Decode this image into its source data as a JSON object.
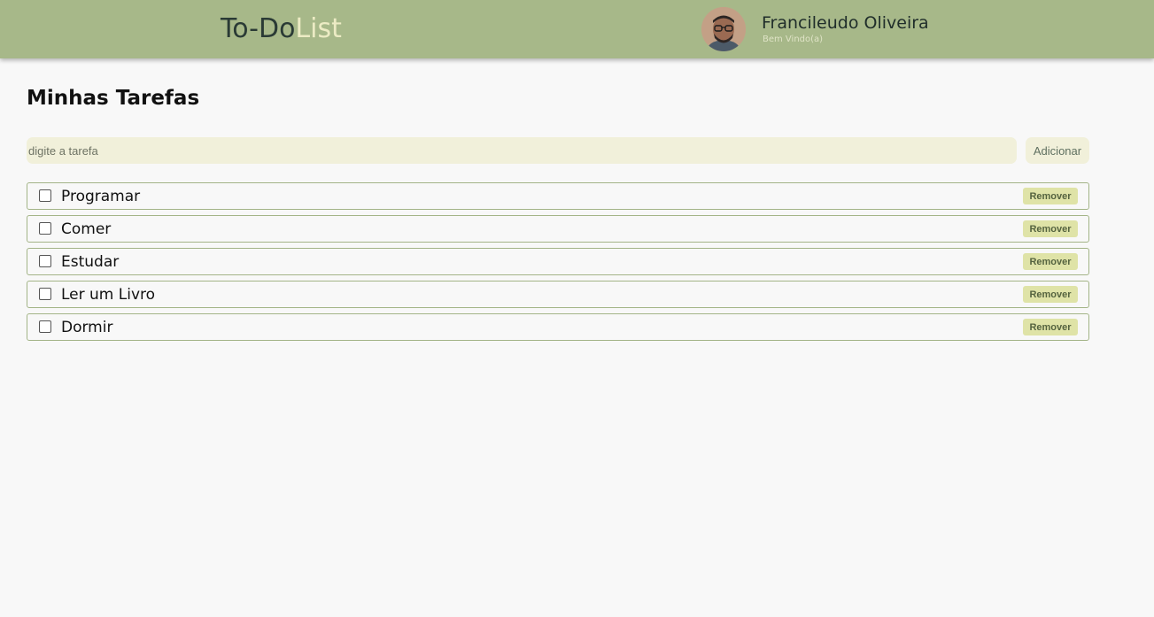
{
  "header": {
    "logo_part1": "To-Do",
    "logo_part2": "List",
    "user_name": "Francileudo Oliveira",
    "user_subtitle": "Bem Vindo(a)"
  },
  "main": {
    "title": "Minhas Tarefas",
    "input_placeholder": "digite a tarefa",
    "input_value": "",
    "add_button_label": "Adicionar",
    "remove_label": "Remover",
    "tasks": [
      {
        "text": "Programar",
        "done": false
      },
      {
        "text": "Comer",
        "done": false
      },
      {
        "text": "Estudar",
        "done": false
      },
      {
        "text": "Ler um Livro",
        "done": false
      },
      {
        "text": "Dormir",
        "done": false
      }
    ]
  },
  "colors": {
    "header_bg": "#a7b889",
    "logo_accent": "#ecebc4",
    "input_bg": "#f1f0da",
    "task_border": "#a3b487",
    "remove_bg": "#dfe3a7"
  }
}
